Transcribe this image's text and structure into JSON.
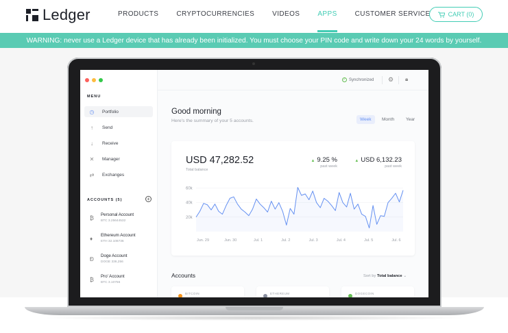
{
  "brand": {
    "name": "Ledger"
  },
  "nav": {
    "items": [
      {
        "label": "PRODUCTS",
        "active": false
      },
      {
        "label": "CRYPTOCURRENCIES",
        "active": false
      },
      {
        "label": "VIDEOS",
        "active": false
      },
      {
        "label": "APPS",
        "active": true
      },
      {
        "label": "CUSTOMER SERVICE",
        "active": false
      }
    ],
    "cart_label": "CART (0)"
  },
  "warning": "WARNING: never use a Ledger device that has already been initialized. You must choose your PIN code and write down your 24 words by yourself.",
  "app": {
    "menu_title": "MENU",
    "menu": [
      {
        "label": "Portfolio",
        "icon": "clock-icon",
        "active": true
      },
      {
        "label": "Send",
        "icon": "send-icon",
        "active": false
      },
      {
        "label": "Receive",
        "icon": "receive-icon",
        "active": false
      },
      {
        "label": "Manager",
        "icon": "tools-icon",
        "active": false
      },
      {
        "label": "Exchanges",
        "icon": "exchange-icon",
        "active": false
      }
    ],
    "accounts_title": "ACCOUNTS (5)",
    "accounts": [
      {
        "name": "Personal Account",
        "balance": "BTC 3.25644532",
        "icon": "bitcoin-icon"
      },
      {
        "name": "Ethereum Account",
        "balance": "ETH 32.108736",
        "icon": "ethereum-icon"
      },
      {
        "name": "Doge Account",
        "balance": "DOGE 336,256",
        "icon": "dogecoin-icon"
      },
      {
        "name": "Pro' Account",
        "balance": "BTC 3.10756",
        "icon": "bitcoin-icon"
      }
    ],
    "sync_label": "Synchronized",
    "greeting": "Good morning",
    "summary": "Here's the summary of your 5 accounts.",
    "periods": [
      {
        "label": "Week",
        "active": true
      },
      {
        "label": "Month",
        "active": false
      },
      {
        "label": "Year",
        "active": false
      }
    ],
    "total": "USD 47,282.52",
    "total_label": "Total balance",
    "stats": [
      {
        "value": "9.25 %",
        "label": "past week"
      },
      {
        "value": "USD 6,132.23",
        "label": "past week"
      }
    ],
    "accounts_heading": "Accounts",
    "sort_prefix": "Sort by",
    "sort_value": "Total balance",
    "account_cards": [
      {
        "label": "BITCOIN",
        "color": "#f7931a"
      },
      {
        "label": "ETHEREUM",
        "color": "#8a8fa0"
      },
      {
        "label": "DOGECOIN",
        "color": "#66be54"
      }
    ]
  },
  "colors": {
    "accent": "#41ccb4",
    "warning_bg": "#5acbb3",
    "chart_line": "#6490f1",
    "positive": "#66be54"
  },
  "chart_data": {
    "type": "line",
    "x_ticks": [
      "Jun. 29",
      "Jun. 30",
      "Jul. 1",
      "Jul. 2",
      "Jul. 3",
      "Jul. 4",
      "Jul. 5",
      "Jul. 6"
    ],
    "y_ticks": [
      "60k",
      "40k",
      "20k"
    ],
    "ylim": [
      0,
      70000
    ],
    "series": [
      {
        "values": [
          20000,
          28000,
          39000,
          37000,
          30000,
          38000,
          28000,
          24000,
          36000,
          46000,
          48000,
          38000,
          31000,
          27000,
          22000,
          31000,
          45000,
          38000,
          33000,
          27000,
          42000,
          31000,
          40000,
          28000,
          9000,
          32000,
          24000,
          61000,
          50000,
          52000,
          44000,
          56000,
          40000,
          33000,
          46000,
          42000,
          36000,
          29000,
          54000,
          40000,
          34000,
          53000,
          31000,
          38000,
          24000,
          21000,
          5000,
          36000,
          10000,
          22000,
          21000,
          40000,
          46000,
          53000,
          41000,
          57000
        ]
      }
    ]
  }
}
